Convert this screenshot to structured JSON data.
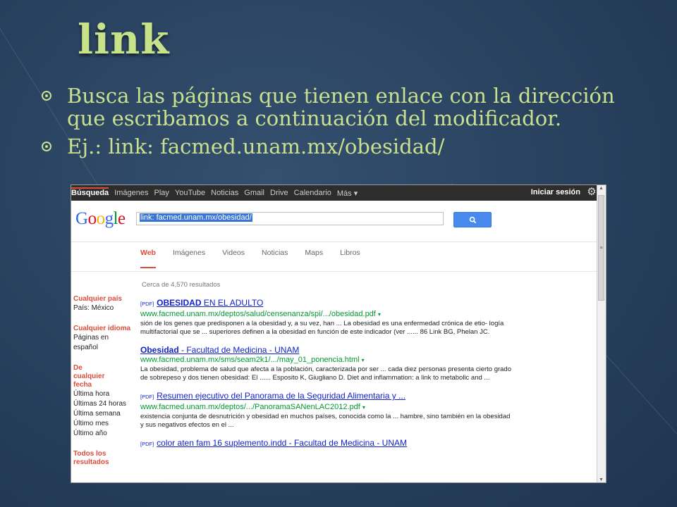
{
  "slide": {
    "title": "link",
    "bullets": [
      "Busca las páginas que tienen enlace con la dirección que escribamos a continuación del modificador.",
      "Ej.: link: facmed.unam.mx/obesidad/"
    ]
  },
  "browser": {
    "gbar_items": [
      "Búsqueda",
      "Imágenes",
      "Play",
      "YouTube",
      "Noticias",
      "Gmail",
      "Drive",
      "Calendario",
      "Más ▾"
    ],
    "signin": "Iniciar sesión",
    "logo": "Google",
    "query": "link: facmed.unam.mx/obesidad/",
    "tabs": [
      "Web",
      "Imágenes",
      "Videos",
      "Noticias",
      "Maps",
      "Libros"
    ],
    "count": "Cerca de 4,570 resultados",
    "sidebar": [
      {
        "heading": "Cualquier país",
        "options": [
          "País: México"
        ]
      },
      {
        "heading": "Cualquier idioma",
        "options": [
          "Páginas en español"
        ]
      },
      {
        "heading": "De cualquier fecha",
        "options": [
          "Última hora",
          "Últimas 24 horas",
          "Última semana",
          "Último mes",
          "Último año"
        ]
      },
      {
        "heading": "Todos los resultados",
        "options": []
      }
    ],
    "results": [
      {
        "pdf": "[PDF]",
        "title_bold": "OBESIDAD",
        "title_rest": " EN EL ADULTO",
        "url": "www.facmed.unam.mx/deptos/salud/censenanza/spi/.../obesidad.pdf",
        "snippet": "sión de los genes que predisponen a la obesidad y, a su vez, han ... La obesidad es una enfermedad crónica de etio- logía multifactorial que se ... superiores definen a la obesidad en función de este indicador (ver ...... 86 Link BG, Phelan JC."
      },
      {
        "pdf": "",
        "title_bold": "Obesidad",
        "title_rest": " - Facultad de Medicina - UNAM",
        "url": "www.facmed.unam.mx/sms/seam2k1/.../may_01_ponencia.html",
        "snippet": "La obesidad, problema de salud que afecta a la población, caracterizada por ser ... cada diez personas presenta cierto grado de sobrepeso y dos tienen obesidad: El ...... Esposito K, Giugliano D. Diet and inflammation: a link to metabolic and ..."
      },
      {
        "pdf": "[PDF]",
        "title_bold": "",
        "title_rest": "Resumen ejecutivo del Panorama de la Seguridad Alimentaria y ...",
        "url": "www.facmed.unam.mx/deptos/.../PanoramaSANenLAC2012.pdf",
        "snippet": "existencia conjunta de desnutrición y obesidad en muchos países, conocida como la ... hambre, sino también en la obesidad y sus negativos efectos en el ..."
      },
      {
        "pdf": "[PDF]",
        "title_bold": "",
        "title_rest": "color aten fam 16 suplemento.indd - Facultad de Medicina - UNAM",
        "url": "",
        "snippet": ""
      }
    ]
  }
}
